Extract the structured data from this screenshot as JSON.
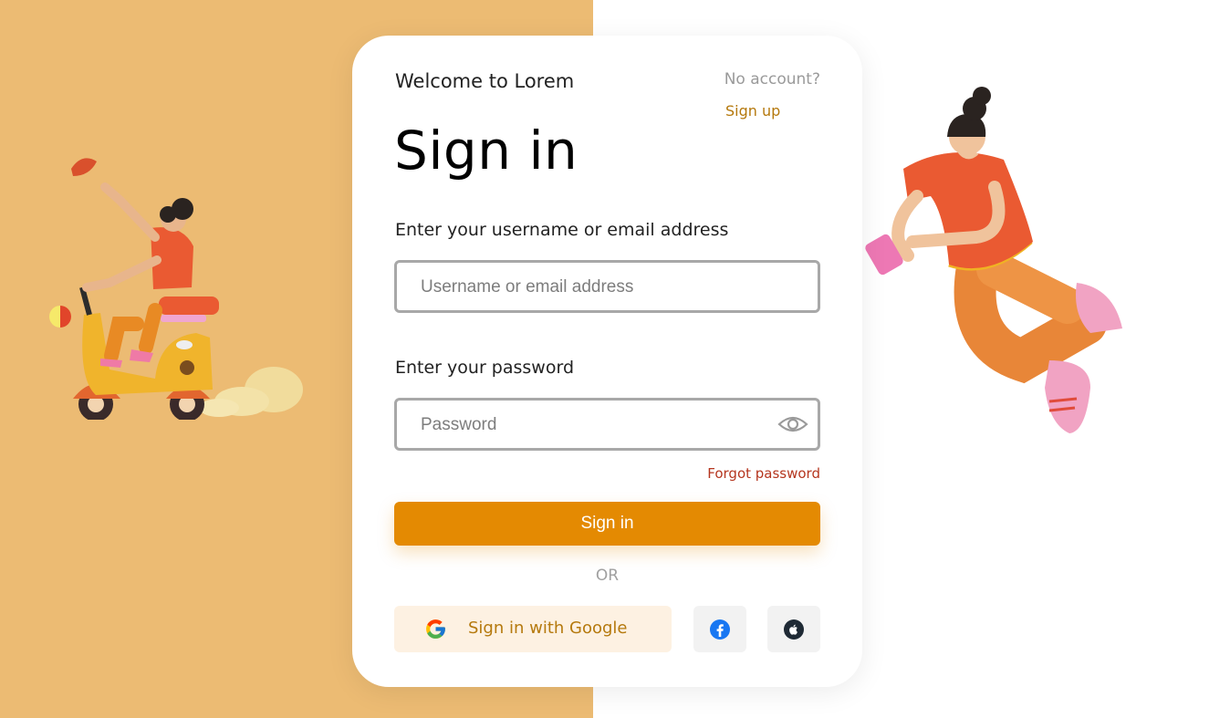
{
  "header": {
    "welcome": "Welcome to Lorem",
    "no_account": "No account?",
    "signup": "Sign up",
    "title": "Sign in"
  },
  "form": {
    "username_label": "Enter your username or email address",
    "username_placeholder": "Username or email address",
    "password_label": "Enter your password",
    "password_placeholder": "Password",
    "forgot": "Forgot password",
    "submit": "Sign in"
  },
  "divider": "OR",
  "social": {
    "google_label": "Sign in with Google",
    "icons": [
      "google-icon",
      "facebook-icon",
      "apple-icon"
    ]
  },
  "colors": {
    "left_bg": "#ecbb73",
    "accent": "#e48a02",
    "link": "#b5790d",
    "forgot": "#b5361f",
    "google_bg": "#fdf1e2",
    "social_bg": "#f2f2f2"
  }
}
